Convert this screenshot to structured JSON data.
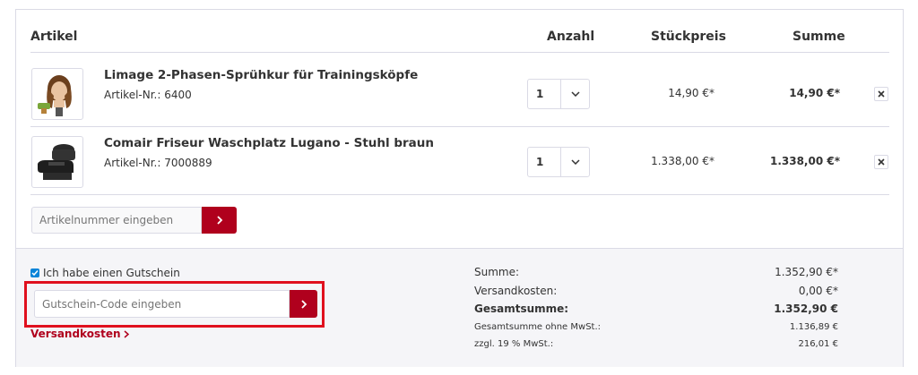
{
  "header": {
    "artikel": "Artikel",
    "anzahl": "Anzahl",
    "stueckpreis": "Stückpreis",
    "summe": "Summe"
  },
  "items": [
    {
      "name": "Limage 2-Phasen-Sprühkur für Trainingsköpfe",
      "article_number": "Artikel-Nr.: 6400",
      "quantity": "1",
      "unit_price": "14,90 €*",
      "total": "14,90 €*",
      "thumbnail_icon": "training-head-icon"
    },
    {
      "name": "Comair Friseur Waschplatz Lugano - Stuhl braun",
      "article_number": "Artikel-Nr.: 7000889",
      "quantity": "1",
      "unit_price": "1.338,00 €*",
      "total": "1.338,00 €*",
      "thumbnail_icon": "wash-station-chair-icon"
    }
  ],
  "add_product": {
    "placeholder": "Artikelnummer eingeben"
  },
  "voucher": {
    "checkbox_label": "Ich habe einen Gutschein",
    "checked": true,
    "placeholder": "Gutschein-Code eingeben"
  },
  "shipping_link": "Versandkosten",
  "summary": {
    "rows": [
      {
        "label": "Summe:",
        "value": "1.352,90 €*"
      },
      {
        "label": "Versandkosten:",
        "value": "0,00 €*"
      },
      {
        "label": "Gesamtsumme:",
        "value": "1.352,90 €"
      },
      {
        "label": "Gesamtsumme ohne MwSt.:",
        "value": "1.136,89 €"
      },
      {
        "label": "zzgl. 19 % MwSt.:",
        "value": "216,01 €"
      }
    ]
  },
  "colors": {
    "accent": "#b0001d",
    "highlight_border": "#e0101e",
    "checkbox": "#0a84d8",
    "border": "#dadae5",
    "footer_bg": "#f5f5f8"
  }
}
